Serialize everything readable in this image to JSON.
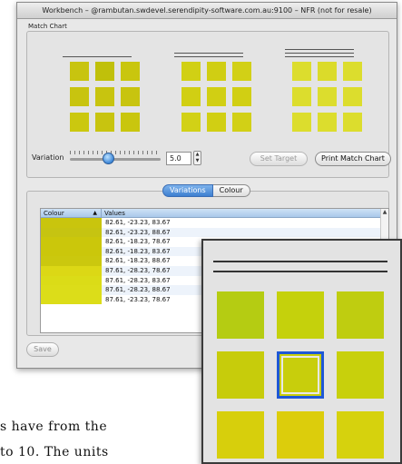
{
  "window": {
    "title": "Workbench – @rambutan.swdevel.serendipity-software.com.au:9100 – NFR (not for resale)"
  },
  "match_chart": {
    "group_label": "Match Chart",
    "groups": [
      {
        "lines": 1,
        "swatches": [
          "#c8c40f",
          "#c0c00a",
          "#c9c60e",
          "#c8c40f",
          "#c8c40f",
          "#c8c40f",
          "#cbc80f",
          "#c8c40f",
          "#c9c60e"
        ]
      },
      {
        "lines": 2,
        "swatches": [
          "#d1d014",
          "#d0ce13",
          "#d2d016",
          "#d1cf13",
          "#d1cf13",
          "#d1cf13",
          "#d2d116",
          "#d1cf13",
          "#d2d016"
        ]
      },
      {
        "lines": 3,
        "swatches": [
          "#dcdd2d",
          "#dbdb2a",
          "#dcdd2d",
          "#dcdd2d",
          "#dcdd2d",
          "#dcdd2d",
          "#dcdd2d",
          "#dcdd2d",
          "#dcdd2d"
        ]
      }
    ]
  },
  "controls": {
    "variation_label": "Variation",
    "variation_value": "5.0",
    "variation_level": 0.42,
    "set_target_label": "Set Target",
    "print_label": "Print Match Chart"
  },
  "tabs": [
    {
      "label": "Variations",
      "selected": true
    },
    {
      "label": "Colour",
      "selected": false
    }
  ],
  "table": {
    "columns": [
      "Colour",
      "Values"
    ],
    "rows": [
      {
        "colour": "#c9c50d",
        "values": "82.61, -23.23, 83.67"
      },
      {
        "colour": "#c6c411",
        "values": "82.61, -23.23, 88.67"
      },
      {
        "colour": "#cbc70b",
        "values": "82.61, -18.23, 78.67"
      },
      {
        "colour": "#cbc70b",
        "values": "82.61, -18.23, 83.67"
      },
      {
        "colour": "#cbc80e",
        "values": "82.61, -18.23, 88.67"
      },
      {
        "colour": "#dcd815",
        "values": "87.61, -28.23, 78.67"
      },
      {
        "colour": "#dbdc17",
        "values": "87.61, -28.23, 83.67"
      },
      {
        "colour": "#dcdd19",
        "values": "87.61, -28.23, 88.67"
      },
      {
        "colour": "#dcdd19",
        "values": "87.61, -23.23, 78.67"
      }
    ]
  },
  "save_label": "Save",
  "zoom": {
    "lines": 2,
    "target_index": 4,
    "swatches": [
      "#b5cc12",
      "#c5d10c",
      "#bfcd10",
      "#c7cc0b",
      "#c8ce0c",
      "#c8d00c",
      "#d7cf0c",
      "#dccd0c",
      "#d6d20d"
    ]
  },
  "page_text": {
    "line1": "s have from the",
    "line2": "to 10. The units"
  }
}
